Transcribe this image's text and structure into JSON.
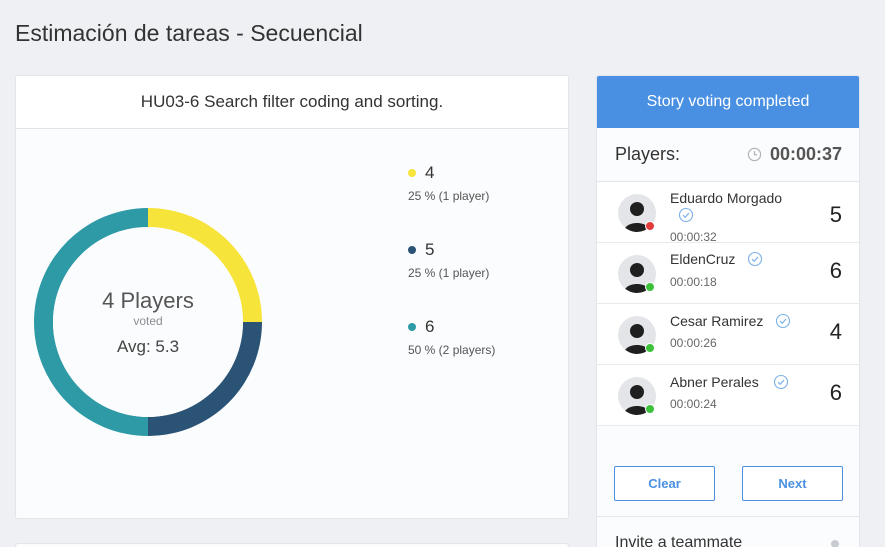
{
  "page": {
    "title": "Estimación de tareas - Secuencial"
  },
  "story": {
    "title": "HU03-6 Search filter coding and sorting."
  },
  "summary": {
    "players_count": "4 Players",
    "voted_label": "voted",
    "average": "Avg: 5.3"
  },
  "chart_data": {
    "type": "pie",
    "title": "",
    "slices": [
      {
        "label": "4",
        "value": 25,
        "color": "#f7e43a",
        "detail": "25 % (1 player)"
      },
      {
        "label": "5",
        "value": 25,
        "color": "#2b5376",
        "detail": "25 % (1 player)"
      },
      {
        "label": "6",
        "value": 50,
        "color": "#2e9aa6",
        "detail": "50 % (2 players)"
      }
    ]
  },
  "panel": {
    "status": "Story voting completed",
    "players_label": "Players:",
    "timer": "00:00:37",
    "players": [
      {
        "name": "Eduardo Morgado",
        "time": "00:00:32",
        "vote": "5",
        "online": false
      },
      {
        "name": "EldenCruz",
        "time": "00:00:18",
        "vote": "6",
        "online": true
      },
      {
        "name": "Cesar Ramirez",
        "time": "00:00:26",
        "vote": "4",
        "online": true
      },
      {
        "name": "Abner Perales",
        "time": "00:00:24",
        "vote": "6",
        "online": true
      }
    ],
    "clear_label": "Clear",
    "next_label": "Next",
    "invite_label": "Invite a teammate"
  },
  "colors": {
    "accent": "#4a90e2",
    "online": "#3cc13b",
    "offline": "#e23b3b"
  }
}
